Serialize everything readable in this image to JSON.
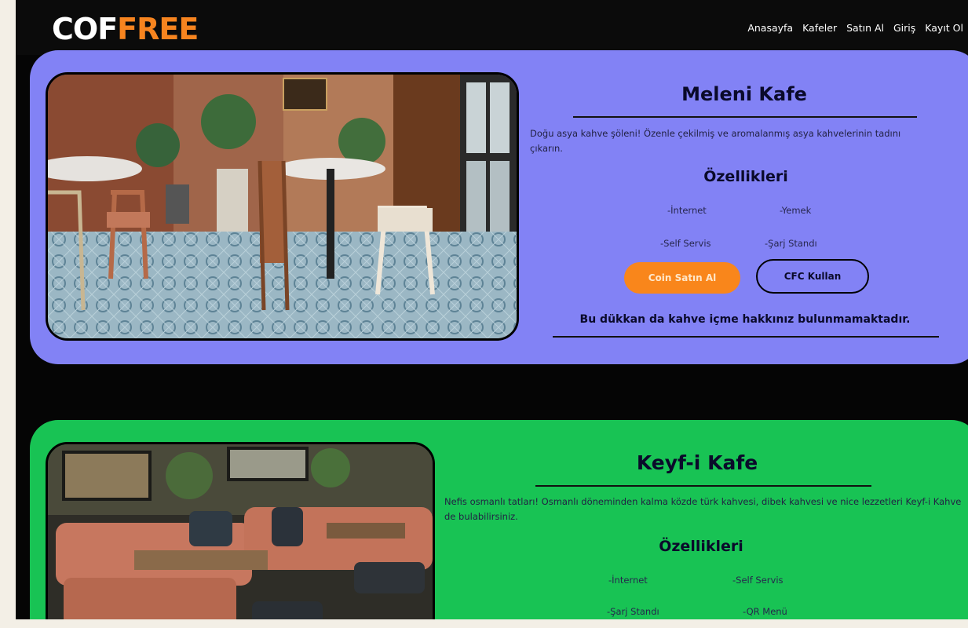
{
  "brand": {
    "part1": "COF",
    "part2": "FREE"
  },
  "nav": [
    "Anasayfa",
    "Kafeler",
    "Satın Al",
    "Giriş",
    "Kayıt Ol"
  ],
  "cafes": [
    {
      "name": "Meleni Kafe",
      "description": "Doğu asya kahve şöleni! Özenle çekilmiş ve aromalanmış asya kahvelerinin tadını çıkarın.",
      "features_title": "Özellikleri",
      "features": [
        "-İnternet",
        "-Yemek",
        "-Self Servis",
        "-Şarj Standı"
      ],
      "buttons": {
        "buy": "Coin Satın Al",
        "use": "CFC Kullan"
      },
      "notice": "Bu dükkan da kahve içme hakkınız bulunmamaktadır.",
      "color": "#8282f5"
    },
    {
      "name": "Keyf-i Kafe",
      "description": "Nefis osmanlı tatları! Osmanlı döneminden kalma közde türk kahvesi, dibek kahvesi ve nice lezzetleri Keyf-i Kahve de bulabilirsiniz.",
      "features_title": "Özellikleri",
      "features": [
        "-İnternet",
        "-Self Servis",
        "-Şarj Standı",
        "-QR Menü"
      ],
      "color": "#18c354"
    }
  ],
  "colors": {
    "accent": "#f7841f",
    "background": "#050505"
  }
}
